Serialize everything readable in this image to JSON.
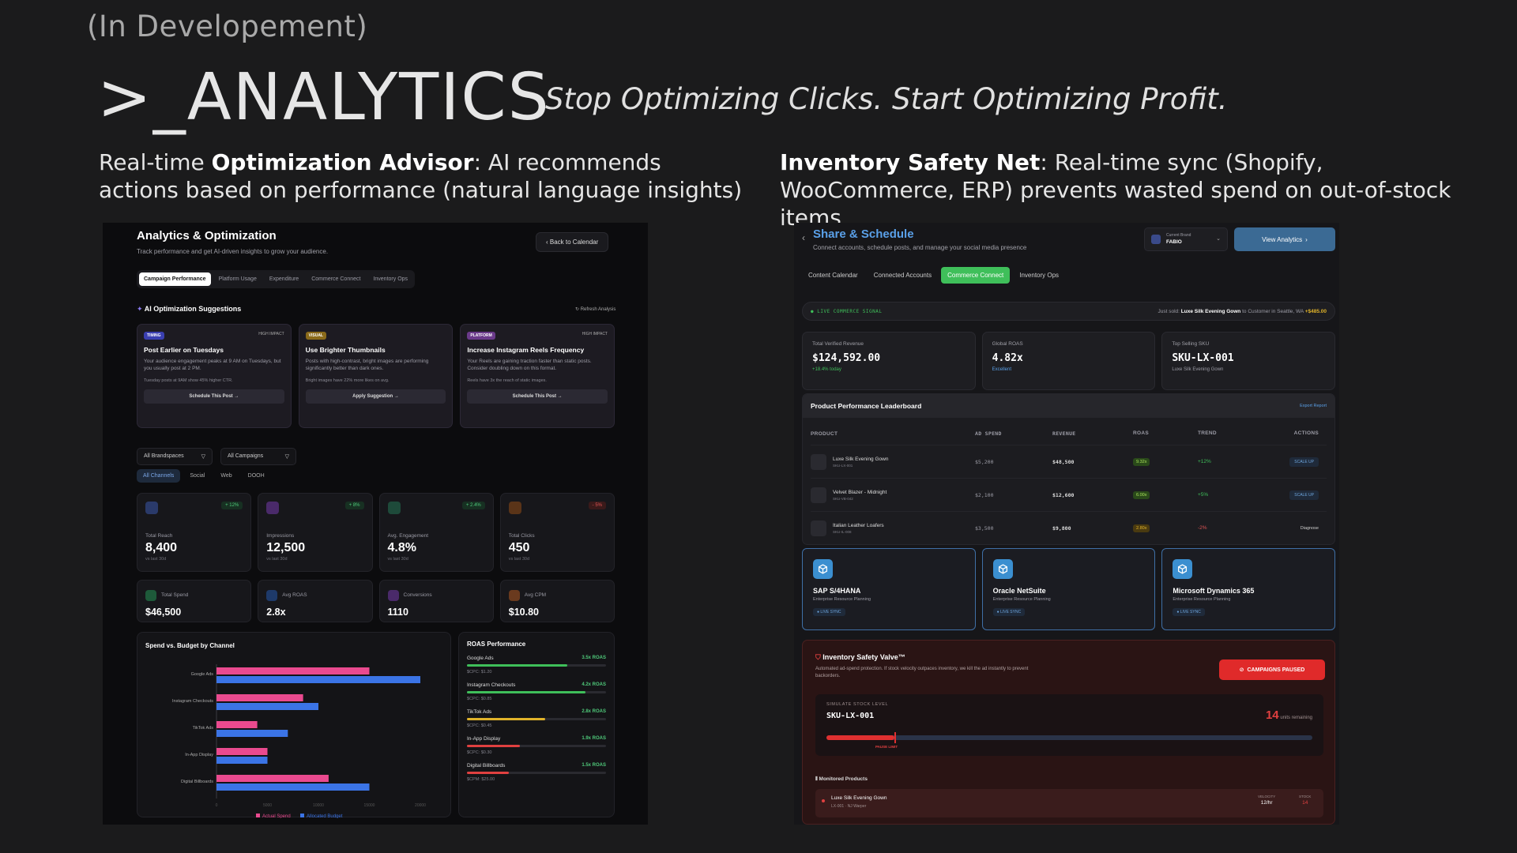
{
  "slide": {
    "dev_label": "(In Developement)",
    "title": ">_ANALYTICS",
    "tagline": "Stop Optimizing Clicks. Start Optimizing Profit.",
    "left_desc_pre": "Real-time ",
    "left_desc_bold": "Optimization Advisor",
    "left_desc_post": ": AI recommends actions based on performance (natural language insights)",
    "right_desc_bold": "Inventory Safety Net",
    "right_desc_post": ": Real-time sync (Shopify, WooCommerce, ERP) prevents wasted spend on out-of-stock items"
  },
  "left": {
    "title": "Analytics & Optimization",
    "subtitle": "Track performance and get AI-driven insights to grow your audience.",
    "back_btn": "Back to Calendar",
    "tabs": [
      "Campaign Performance",
      "Platform Usage",
      "Expenditure",
      "Commerce Connect",
      "Inventory Ops"
    ],
    "ai_heading": "AI Optimization Suggestions",
    "refresh": "Refresh Analysis",
    "suggestions": [
      {
        "tag": "TIMING",
        "impact": "HIGH IMPACT",
        "title": "Post Earlier on Tuesdays",
        "body": "Your audience engagement peaks at 9 AM on Tuesdays, but you usually post at 2 PM.",
        "note": "Tuesday posts at 9AM show 45% higher CTR.",
        "action": "Schedule This Post →",
        "tag_color": "#3a3fb0"
      },
      {
        "tag": "VISUAL",
        "impact": "",
        "title": "Use Brighter Thumbnails",
        "body": "Posts with high-contrast, bright images are performing significantly better than dark ones.",
        "note": "Bright images have 22% more likes on avg.",
        "action": "Apply Suggestion →",
        "tag_color": "#8a6a1a"
      },
      {
        "tag": "PLATFORM",
        "impact": "HIGH IMPACT",
        "title": "Increase Instagram Reels Frequency",
        "body": "Your Reels are gaining traction faster than static posts. Consider doubling down on this format.",
        "note": "Reels have 3x the reach of static images.",
        "action": "Schedule This Post →",
        "tag_color": "#6a3a8a"
      }
    ],
    "filters": [
      "All Brandspaces",
      "All Campaigns"
    ],
    "channels": [
      "All Channels",
      "Social",
      "Web",
      "DOOH"
    ],
    "kpis": [
      {
        "label": "Total Reach",
        "value": "8,400",
        "delta": "+ 12%",
        "vs": "vs last 30d",
        "color": "#2a3a6a",
        "delta_color": "#4fc97a"
      },
      {
        "label": "Impressions",
        "value": "12,500",
        "delta": "+ 8%",
        "vs": "vs last 30d",
        "color": "#4a2a6a",
        "delta_color": "#4fc97a"
      },
      {
        "label": "Avg. Engagement",
        "value": "4.8%",
        "delta": "+ 2.4%",
        "vs": "vs last 30d",
        "color": "#1e4a3a",
        "delta_color": "#4fc97a"
      },
      {
        "label": "Total Clicks",
        "value": "450",
        "delta": "- 5%",
        "vs": "vs last 30d",
        "color": "#5a3418",
        "delta_color": "#e05454"
      }
    ],
    "kpis2": [
      {
        "label": "Total Spend",
        "value": "$46,500",
        "color": "#1e5a3a"
      },
      {
        "label": "Avg ROAS",
        "value": "2.8x",
        "color": "#1e3a6a"
      },
      {
        "label": "Conversions",
        "value": "1110",
        "color": "#4a2a6a"
      },
      {
        "label": "Avg CPM",
        "value": "$10.80",
        "color": "#6a3a1e"
      }
    ],
    "spend_title": "Spend vs. Budget by Channel",
    "legend_actual": "Actual Spend",
    "legend_alloc": "Allocated Budget",
    "roas_title": "ROAS Performance",
    "roas": [
      {
        "name": "Google Ads",
        "roas": "3.5x ROAS",
        "cpc": "$CPC: $1.20",
        "pct": 0.72,
        "color": "#3fbf5a"
      },
      {
        "name": "Instagram Checkouts",
        "roas": "4.2x ROAS",
        "cpc": "$CPC: $0.85",
        "pct": 0.85,
        "color": "#3fbf5a"
      },
      {
        "name": "TikTok Ads",
        "roas": "2.8x ROAS",
        "cpc": "$CPC: $0.45",
        "pct": 0.56,
        "color": "#e0b32a"
      },
      {
        "name": "In-App Display",
        "roas": "1.9x ROAS",
        "cpc": "$CPC: $0.30",
        "pct": 0.38,
        "color": "#e04040"
      },
      {
        "name": "Digital Billboards",
        "roas": "1.5x ROAS",
        "cpc": "$CPM: $25.00",
        "pct": 0.3,
        "color": "#e04040"
      }
    ]
  },
  "chart_data": {
    "type": "bar",
    "title": "Spend vs. Budget by Channel",
    "categories": [
      "Google Ads",
      "Instagram Checkouts",
      "TikTok Ads",
      "In-App Display",
      "Digital Billboards"
    ],
    "series": [
      {
        "name": "Actual Spend",
        "values": [
          15000,
          8500,
          4000,
          5000,
          11000
        ]
      },
      {
        "name": "Allocated Budget",
        "values": [
          20000,
          10000,
          7000,
          5000,
          15000
        ]
      }
    ],
    "xlim": [
      0,
      20000
    ],
    "xticks": [
      "0",
      "5000",
      "10000",
      "15000",
      "20000"
    ],
    "colors": {
      "Actual Spend": "#ea4a8f",
      "Allocated Budget": "#3b74e6"
    }
  },
  "right": {
    "title": "Share & Schedule",
    "subtitle": "Connect accounts, schedule posts, and manage your social media presence",
    "brand_label": "Current Brand",
    "brand_value": "FABIO",
    "view_btn": "View Analytics",
    "tabs": [
      "Content Calendar",
      "Connected Accounts",
      "Commerce Connect",
      "Inventory Ops"
    ],
    "live_label": "LIVE COMMERCE SIGNAL",
    "live_pre": "Just sold:",
    "live_product": "Luxe Silk Evening Gown",
    "live_mid": "to Customer in Seattle, WA",
    "live_amount": "+$485.00",
    "stats": [
      {
        "label": "Total Verified Revenue",
        "value": "$124,592.00",
        "sub": "+18.4% today",
        "sub_color": "#3fbf5a"
      },
      {
        "label": "Global ROAS",
        "value": "4.82x",
        "sub": "Excellent",
        "sub_color": "#5aa0e8"
      },
      {
        "label": "Top Selling SKU",
        "value": "SKU-LX-001",
        "sub": "Luxe Silk Evening Gown",
        "sub_color": "#9c9ca6"
      }
    ],
    "leader_title": "Product Performance Leaderboard",
    "export": "Export Report",
    "cols": [
      "PRODUCT",
      "AD SPEND",
      "REVENUE",
      "ROAS",
      "TREND",
      "ACTIONS"
    ],
    "rows": [
      {
        "name": "Luxe Silk Evening Gown",
        "sku": "SKU-LX-001",
        "spend": "$5,200",
        "rev": "$48,500",
        "roas": "9.32x",
        "trend": "+12%",
        "trend_color": "#3fbf5a",
        "action": "SCALE UP",
        "roas_bg": "#2a4a1a",
        "roas_color": "#a8e05a"
      },
      {
        "name": "Velvet Blazer - Midnight",
        "sku": "SKU-VB-042",
        "spend": "$2,100",
        "rev": "$12,600",
        "roas": "6.00x",
        "trend": "+5%",
        "trend_color": "#3fbf5a",
        "action": "SCALE UP",
        "roas_bg": "#2a4a1a",
        "roas_color": "#a8e05a"
      },
      {
        "name": "Italian Leather Loafers",
        "sku": "SKU-IL-008",
        "spend": "$3,500",
        "rev": "$9,800",
        "roas": "2.80x",
        "trend": "-2%",
        "trend_color": "#e05454",
        "action": "Diagnose",
        "roas_bg": "#4a3a10",
        "roas_color": "#e0b32a"
      }
    ],
    "erps": [
      {
        "name": "SAP S/4HANA",
        "sub": "Enterprise Resource Planning",
        "sync": "● LIVE SYNC"
      },
      {
        "name": "Oracle NetSuite",
        "sub": "Enterprise Resource Planning",
        "sync": "● LIVE SYNC"
      },
      {
        "name": "Microsoft Dynamics 365",
        "sub": "Enterprise Resource Planning",
        "sync": "● LIVE SYNC"
      }
    ],
    "valve_title": "Inventory Safety Valve™",
    "valve_sub": "Automated ad-spend protection. If stock velocity outpaces inventory, we kill the ad instantly to prevent backorders.",
    "paused_btn": "CAMPAIGNS PAUSED",
    "sim_label": "SIMULATE STOCK LEVEL",
    "sim_sku": "SKU-LX-001",
    "units_value": "14",
    "units_label": "units remaining",
    "pause_limit": "PAUSE LIMIT",
    "stock_fraction": 0.14,
    "monitored": "Monitored Products",
    "mon_name": "Luxe Silk Evening Gown",
    "mon_sku": "LX-001",
    "mon_loc": "NJ Warper",
    "mon_velocity_label": "VELOCITY",
    "mon_velocity": "12/hr",
    "mon_stock_label": "STOCK",
    "mon_stock": "14"
  }
}
